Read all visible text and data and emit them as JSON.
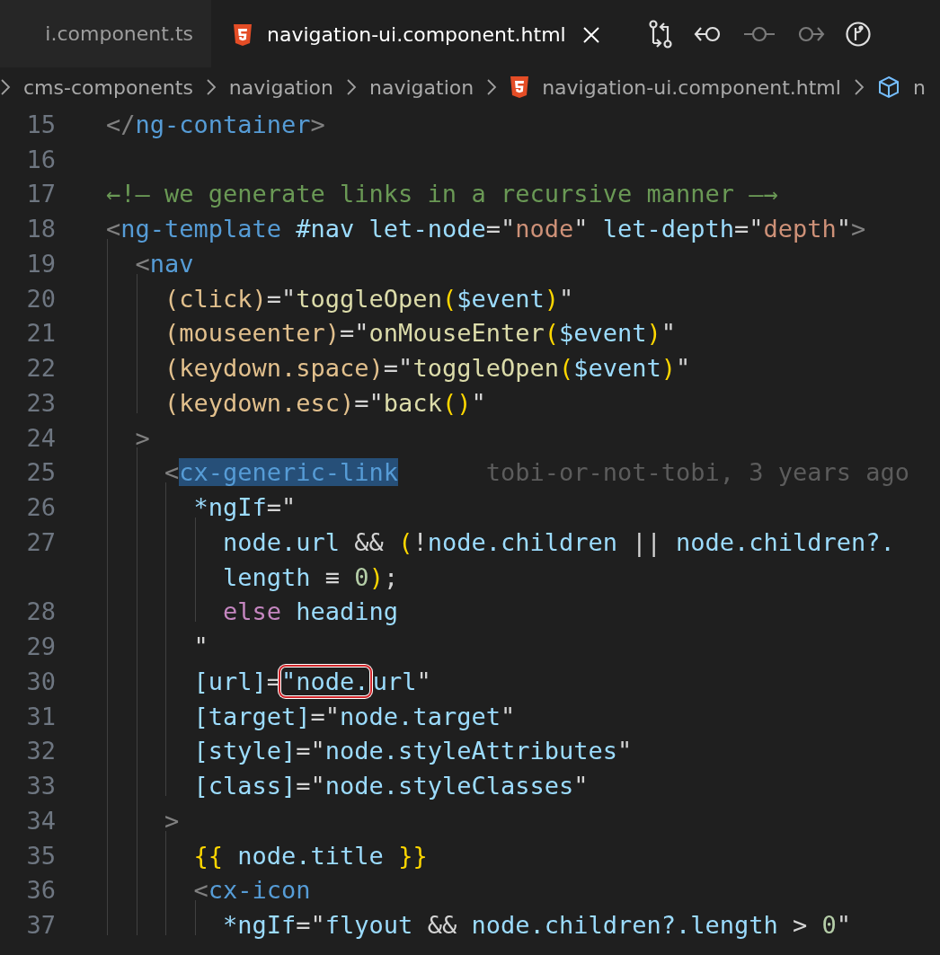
{
  "tabs": [
    {
      "label": "i.component.ts",
      "selected": false
    },
    {
      "kind": "html",
      "label": "navigation-ui.component.html",
      "selected": true
    }
  ],
  "toolbar": [
    {
      "kind": "compare",
      "disabled": false
    },
    {
      "kind": "back",
      "disabled": false
    },
    {
      "kind": "commit",
      "disabled": true
    },
    {
      "kind": "forward",
      "disabled": true
    },
    {
      "kind": "graph",
      "disabled": false
    }
  ],
  "breadcrumbs": [
    {
      "label": "cms-components"
    },
    {
      "label": "navigation"
    },
    {
      "label": "navigation"
    },
    {
      "kind": "html",
      "label": "navigation-ui.component.html"
    },
    {
      "kind": "symbol",
      "label": "n"
    }
  ],
  "editor": {
    "lines": [
      {
        "number": "15",
        "tokens": [
          {
            "kind": "punct",
            "text": "</"
          },
          {
            "kind": "tag",
            "text": "ng-container"
          },
          {
            "kind": "punct",
            "text": ">"
          }
        ]
      },
      {
        "number": "16"
      },
      {
        "number": "17",
        "tokens": [
          {
            "kind": "comment",
            "text": "←!— we generate links in a recursive manner —→"
          }
        ]
      },
      {
        "number": "18",
        "tokens": [
          {
            "kind": "punct",
            "text": "<"
          },
          {
            "kind": "tag",
            "text": "ng-template"
          },
          {
            "kind": "attr",
            "text": " #nav let-node"
          },
          {
            "kind": "op",
            "text": "=\""
          },
          {
            "kind": "string",
            "text": "node"
          },
          {
            "kind": "op",
            "text": "\""
          },
          {
            "kind": "attr",
            "text": " let-depth"
          },
          {
            "kind": "op",
            "text": "=\""
          },
          {
            "kind": "string",
            "text": "depth"
          },
          {
            "kind": "op",
            "text": "\""
          },
          {
            "kind": "punct",
            "text": ">"
          }
        ]
      },
      {
        "number": "19",
        "tokens": [
          {
            "kind": "punct",
            "text": "  <"
          },
          {
            "kind": "tag",
            "text": "nav"
          }
        ]
      },
      {
        "number": "20",
        "tokens": [
          {
            "kind": "event",
            "text": "    (click)"
          },
          {
            "kind": "op",
            "text": "=\""
          },
          {
            "kind": "func",
            "text": "toggleOpen"
          },
          {
            "kind": "bracket",
            "text": "("
          },
          {
            "kind": "var",
            "text": "$event"
          },
          {
            "kind": "bracket",
            "text": ")"
          },
          {
            "kind": "op",
            "text": "\""
          }
        ]
      },
      {
        "number": "21",
        "tokens": [
          {
            "kind": "event",
            "text": "    (mouseenter)"
          },
          {
            "kind": "op",
            "text": "=\""
          },
          {
            "kind": "func",
            "text": "onMouseEnter"
          },
          {
            "kind": "bracket",
            "text": "("
          },
          {
            "kind": "var",
            "text": "$event"
          },
          {
            "kind": "bracket",
            "text": ")"
          },
          {
            "kind": "op",
            "text": "\""
          }
        ]
      },
      {
        "number": "22",
        "tokens": [
          {
            "kind": "event",
            "text": "    (keydown.space)"
          },
          {
            "kind": "op",
            "text": "=\""
          },
          {
            "kind": "func",
            "text": "toggleOpen"
          },
          {
            "kind": "bracket",
            "text": "("
          },
          {
            "kind": "var",
            "text": "$event"
          },
          {
            "kind": "bracket",
            "text": ")"
          },
          {
            "kind": "op",
            "text": "\""
          }
        ]
      },
      {
        "number": "23",
        "tokens": [
          {
            "kind": "event",
            "text": "    (keydown.esc)"
          },
          {
            "kind": "op",
            "text": "=\""
          },
          {
            "kind": "func",
            "text": "back"
          },
          {
            "kind": "bracket",
            "text": "()"
          },
          {
            "kind": "op",
            "text": "\""
          }
        ]
      },
      {
        "number": "24",
        "tokens": [
          {
            "kind": "punct",
            "text": "  >"
          }
        ]
      },
      {
        "number": "25",
        "tokens": [
          {
            "kind": "punct",
            "text": "    <"
          },
          {
            "kind": "tag",
            "text": "cx-generic-link",
            "highlighted": true
          }
        ],
        "blame": "tobi-or-not-tobi, 3 years ago"
      },
      {
        "number": "26",
        "tokens": [
          {
            "kind": "attr",
            "text": "      *ngIf"
          },
          {
            "kind": "op",
            "text": "=\""
          }
        ]
      },
      {
        "number": "27",
        "tokens": [
          {
            "kind": "var",
            "text": "        node.url"
          },
          {
            "kind": "op",
            "text": " && "
          },
          {
            "kind": "bracket",
            "text": "("
          },
          {
            "kind": "op",
            "text": "!"
          },
          {
            "kind": "var",
            "text": "node.children"
          },
          {
            "kind": "op",
            "text": " || "
          },
          {
            "kind": "var",
            "text": "node.children?."
          }
        ]
      },
      {
        "tokens": [
          {
            "kind": "var",
            "text": "        length"
          },
          {
            "kind": "op",
            "text": " ≡ "
          },
          {
            "kind": "number",
            "text": "0"
          },
          {
            "kind": "bracket",
            "text": ")"
          },
          {
            "kind": "op",
            "text": ";"
          }
        ]
      },
      {
        "number": "28",
        "tokens": [
          {
            "kind": "keyword",
            "text": "        else"
          },
          {
            "kind": "var",
            "text": " heading"
          }
        ]
      },
      {
        "number": "29",
        "tokens": [
          {
            "kind": "op",
            "text": "      \""
          }
        ]
      },
      {
        "number": "30",
        "tokens": [
          {
            "kind": "attr",
            "text": "      [url]"
          },
          {
            "kind": "op",
            "text": "="
          },
          {
            "kind": "var",
            "text": "\"node.",
            "outlined": true
          },
          {
            "kind": "var",
            "text": "url"
          },
          {
            "kind": "op",
            "text": "\""
          }
        ]
      },
      {
        "number": "31",
        "tokens": [
          {
            "kind": "attr",
            "text": "      [target]"
          },
          {
            "kind": "op",
            "text": "=\""
          },
          {
            "kind": "var",
            "text": "node.target"
          },
          {
            "kind": "op",
            "text": "\""
          }
        ]
      },
      {
        "number": "32",
        "tokens": [
          {
            "kind": "attr",
            "text": "      [style]"
          },
          {
            "kind": "op",
            "text": "=\""
          },
          {
            "kind": "var",
            "text": "node.styleAttributes"
          },
          {
            "kind": "op",
            "text": "\""
          }
        ]
      },
      {
        "number": "33",
        "tokens": [
          {
            "kind": "attr",
            "text": "      [class]"
          },
          {
            "kind": "op",
            "text": "=\""
          },
          {
            "kind": "var",
            "text": "node.styleClasses"
          },
          {
            "kind": "op",
            "text": "\""
          }
        ]
      },
      {
        "number": "34",
        "tokens": [
          {
            "kind": "punct",
            "text": "    >"
          }
        ]
      },
      {
        "number": "35",
        "tokens": [
          {
            "kind": "bracket",
            "text": "      {{"
          },
          {
            "kind": "var",
            "text": " node.title "
          },
          {
            "kind": "bracket",
            "text": "}}"
          }
        ]
      },
      {
        "number": "36",
        "tokens": [
          {
            "kind": "punct",
            "text": "      <"
          },
          {
            "kind": "tag",
            "text": "cx-icon"
          }
        ]
      },
      {
        "number": "37",
        "tokens": [
          {
            "kind": "attr",
            "text": "        *ngIf"
          },
          {
            "kind": "op",
            "text": "=\""
          },
          {
            "kind": "var",
            "text": "flyout"
          },
          {
            "kind": "op",
            "text": " && "
          },
          {
            "kind": "var",
            "text": "node.children?.length"
          },
          {
            "kind": "op",
            "text": " > "
          },
          {
            "kind": "number",
            "text": "0"
          },
          {
            "kind": "op",
            "text": "\""
          }
        ]
      }
    ]
  }
}
